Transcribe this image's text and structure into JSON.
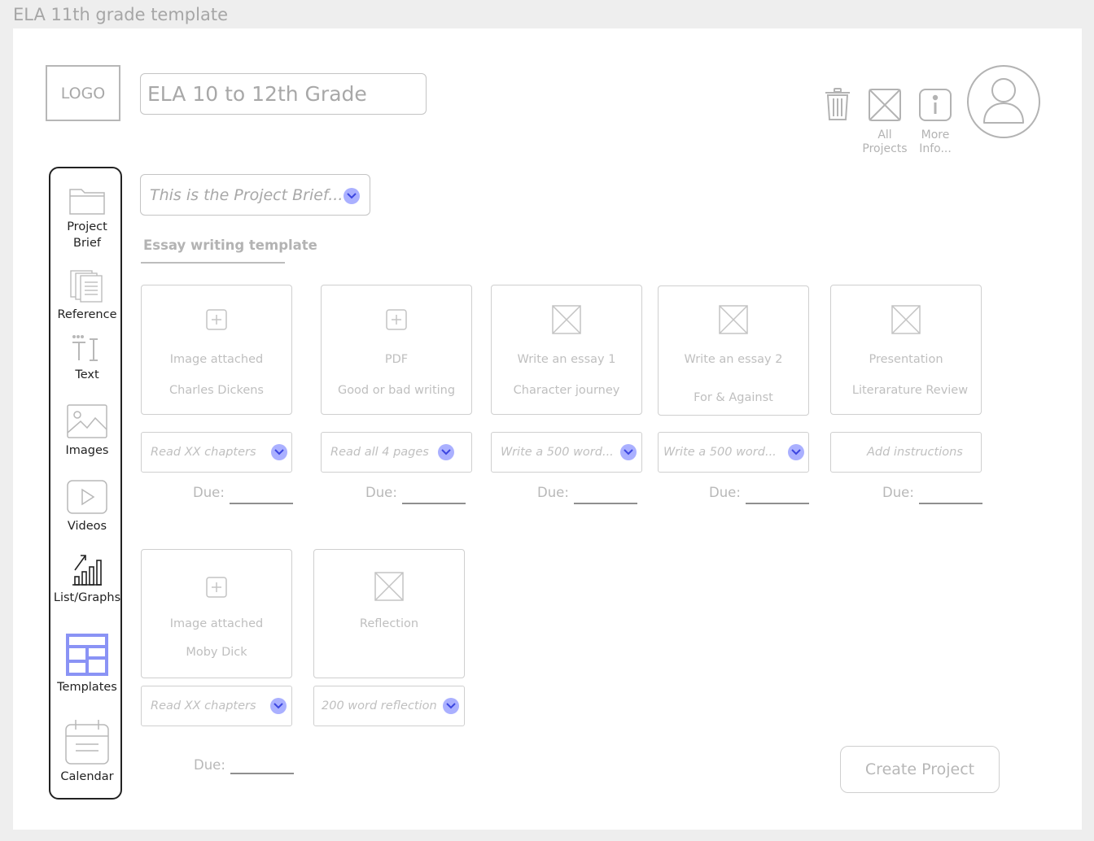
{
  "frame": {
    "title": "ELA 11th grade template"
  },
  "header": {
    "logo": "LOGO",
    "project_name": "ELA 10 to 12th Grade",
    "actions": {
      "all_projects": [
        "All",
        "Projects"
      ],
      "more_info": [
        "More",
        "Info..."
      ]
    }
  },
  "sidebar": {
    "items": [
      {
        "label_lines": [
          "Project",
          "Brief"
        ],
        "icon": "folder-icon"
      },
      {
        "label": "Reference",
        "icon": "documents-icon"
      },
      {
        "label": "Text",
        "icon": "text-icon"
      },
      {
        "label": "Images",
        "icon": "image-icon"
      },
      {
        "label": "Videos",
        "icon": "play-icon"
      },
      {
        "label": "List/Graphs",
        "icon": "chart-icon"
      },
      {
        "label": "Templates",
        "icon": "templates-icon"
      },
      {
        "label": "Calendar",
        "icon": "calendar-icon"
      }
    ]
  },
  "brief": {
    "selected": "This is the Project Brief..."
  },
  "template_tab": "Essay writing template",
  "due_label": "Due:",
  "cards": [
    {
      "title": "Image attached",
      "subtitle": "Charles Dickens",
      "icon": "add-icon",
      "instruction": "Read XX chapters"
    },
    {
      "title": "PDF",
      "subtitle": "Good or bad writing",
      "icon": "add-icon",
      "instruction": "Read all 4 pages"
    },
    {
      "title": "Write an essay 1",
      "subtitle": "Character journey",
      "icon": "placeholder-image-icon",
      "instruction": "Write a 500 word..."
    },
    {
      "title": "Write an essay 2",
      "subtitle": "For & Against",
      "icon": "placeholder-image-icon",
      "instruction": "Write a 500 word..."
    },
    {
      "title": "Presentation",
      "subtitle": "Literarature Review",
      "icon": "placeholder-image-icon",
      "instruction": "Add instructions"
    },
    {
      "title": "Image attached",
      "subtitle": "Moby Dick",
      "icon": "add-icon",
      "instruction": "Read XX chapters"
    },
    {
      "title": "Reflection",
      "subtitle": "",
      "icon": "placeholder-image-icon",
      "instruction": "200 word reflection"
    }
  ],
  "create_button": "Create Project",
  "colors": {
    "accent": "#8a93f5",
    "chevron_bg": "#aab0ff",
    "muted_text": "#b3b3b3"
  }
}
